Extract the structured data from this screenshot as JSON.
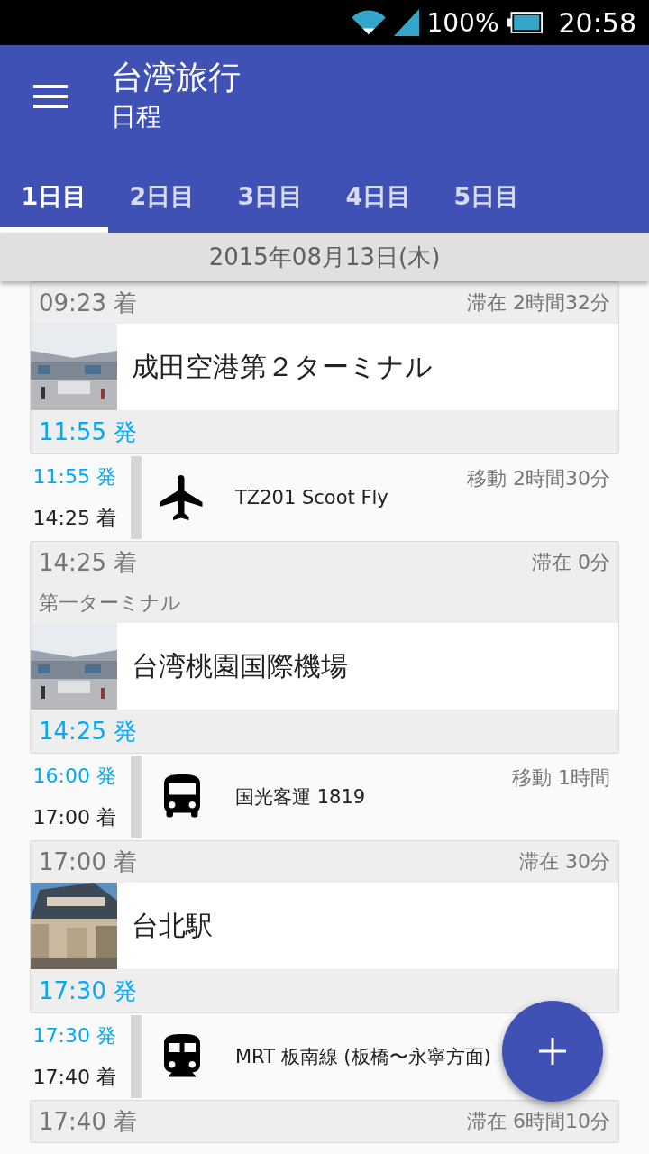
{
  "status_bar": {
    "battery": "100%",
    "time": "20:58"
  },
  "app_bar": {
    "title": "台湾旅行",
    "subtitle": "日程"
  },
  "tabs": [
    {
      "label": "1日目",
      "selected": true
    },
    {
      "label": "2日目",
      "selected": false
    },
    {
      "label": "3日目",
      "selected": false
    },
    {
      "label": "4日目",
      "selected": false
    },
    {
      "label": "5日目",
      "selected": false
    }
  ],
  "date": "2015年08月13日(木)",
  "timeline": [
    {
      "kind": "stop",
      "arrival": "09:23 着",
      "stay": "滞在 2時間32分",
      "place": "成田空港第２ターミナル",
      "departure": "11:55 発"
    },
    {
      "kind": "plane",
      "departure": "11:55 発",
      "arrival": "14:25 着",
      "name": "TZ201 Scoot Fly",
      "duration": "移動 2時間30分"
    },
    {
      "kind": "stop",
      "arrival": "14:25 着",
      "stay": "滞在 0分",
      "note": "第一ターミナル",
      "place": "台湾桃園国際機場",
      "departure": "14:25 発"
    },
    {
      "kind": "bus",
      "departure": "16:00 発",
      "arrival": "17:00 着",
      "name": "国光客運 1819",
      "duration": "移動 1時間"
    },
    {
      "kind": "stop",
      "arrival": "17:00 着",
      "stay": "滞在 30分",
      "place": "台北駅",
      "departure": "17:30 発"
    },
    {
      "kind": "train",
      "departure": "17:30 発",
      "arrival": "17:40 着",
      "name": "MRT 板南線 (板橋〜永寧方面)"
    },
    {
      "kind": "stop",
      "arrival": "17:40 着",
      "stay": "滞在 6時間10分"
    }
  ]
}
